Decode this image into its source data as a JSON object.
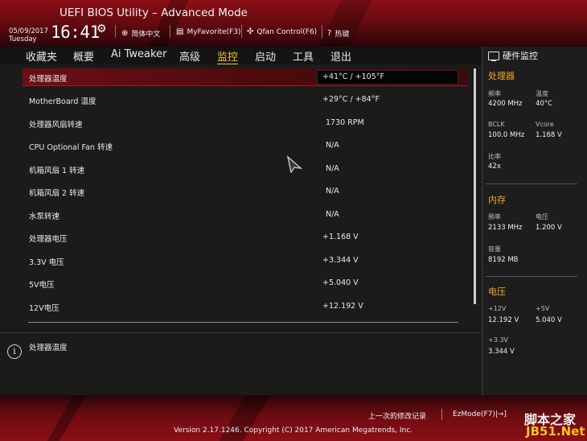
{
  "header": {
    "title": "UEFI BIOS Utility – Advanced Mode",
    "date": "05/09/2017",
    "weekday": "Tuesday",
    "time": "16:41",
    "language": "简体中文",
    "myfavorite": "MyFavorite(F3)",
    "qfan": "Qfan Control(F6)",
    "hotkeys": "热键"
  },
  "menu": {
    "items": [
      "收藏夹",
      "概要",
      "Ai Tweaker",
      "高级",
      "监控",
      "启动",
      "工具",
      "退出"
    ],
    "active": "监控"
  },
  "monitor_rows": [
    {
      "label": "处理器温度",
      "value": "+41°C / +105°F"
    },
    {
      "label": "MotherBoard 温度",
      "value": "+29°C / +84°F"
    },
    {
      "label": "处理器风扇转速",
      "value": "1730 RPM"
    },
    {
      "label": "CPU Optional Fan 转速",
      "value": "N/A"
    },
    {
      "label": "机箱风扇 1 转速",
      "value": "N/A"
    },
    {
      "label": "机箱风扇 2 转速",
      "value": "N/A"
    },
    {
      "label": "水泵转速",
      "value": "N/A"
    },
    {
      "label": "处理器电压",
      "value": "+1.168 V"
    },
    {
      "label": "3.3V 电压",
      "value": "+3.344 V"
    },
    {
      "label": "5V电压",
      "value": "+5.040 V"
    },
    {
      "label": "12V电压",
      "value": "+12.192 V"
    }
  ],
  "help_text": "处理器温度",
  "sidebar": {
    "title": "硬件监控",
    "cpu": {
      "section": "处理器",
      "freq_label": "频率",
      "freq": "4200 MHz",
      "temp_label": "温度",
      "temp": "40°C",
      "bclk_label": "BCLK",
      "bclk": "100.0 MHz",
      "vcore_label": "Vcore",
      "vcore": "1.168 V",
      "ratio_label": "比率",
      "ratio": "42x"
    },
    "memory": {
      "section": "内存",
      "freq_label": "频率",
      "freq": "2133 MHz",
      "volt_label": "电压",
      "volt": "1.200 V",
      "cap_label": "容量",
      "cap": "8192 MB"
    },
    "voltage": {
      "section": "电压",
      "v12_label": "+12V",
      "v12": "12.192 V",
      "v5_label": "+5V",
      "v5": "5.040 V",
      "v33_label": "+3.3V",
      "v33": "3.344 V"
    }
  },
  "footer": {
    "last_change": "上一次的修改记录",
    "ezmode": "EzMode(F7)|→]",
    "version": "Version 2.17.1246. Copyright (C) 2017 American Megatrends, Inc.",
    "watermark_top": "脚本之家",
    "watermark_bottom": "JB51.Net"
  },
  "colors": {
    "accent": "#f5c518",
    "section": "#f5a623",
    "brand_red": "#8d0f16"
  }
}
